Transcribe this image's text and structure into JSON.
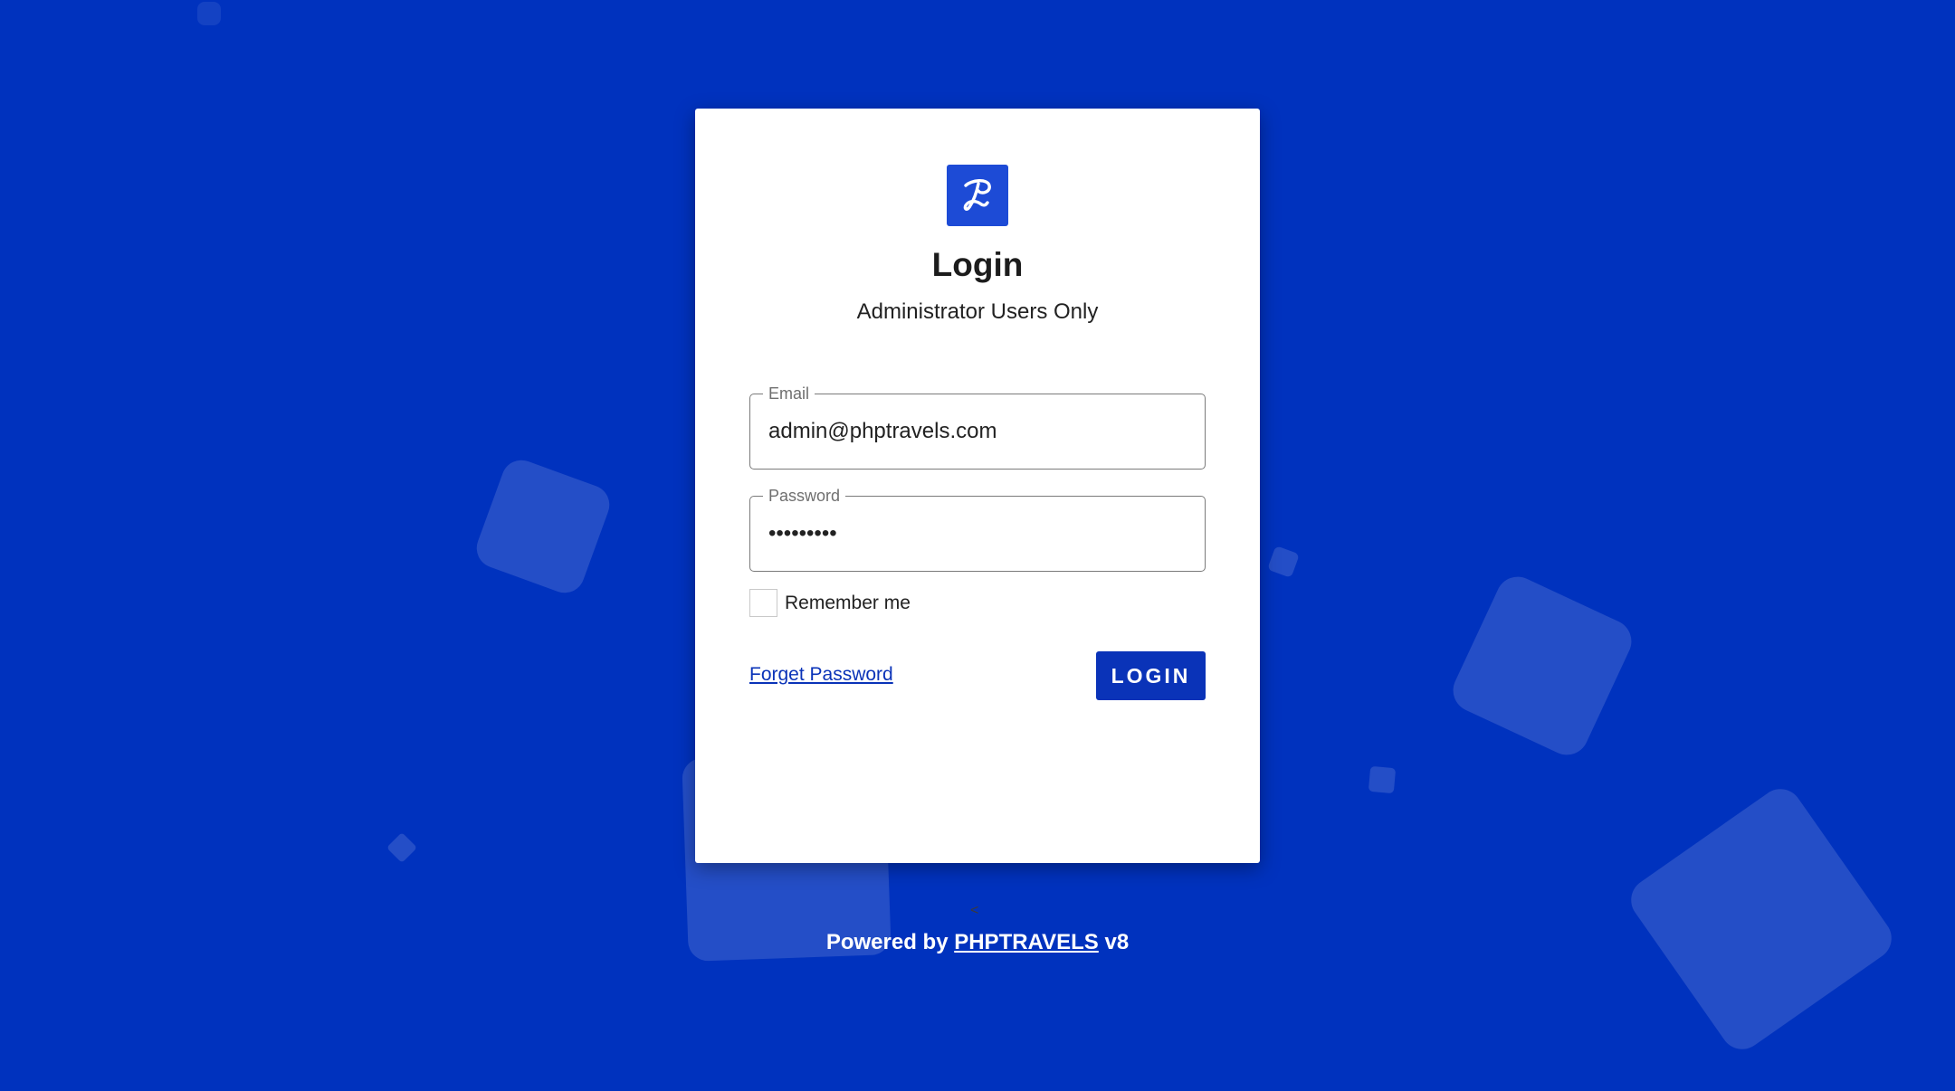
{
  "brand": {
    "logo_icon": "phptravels-p-logo-icon",
    "background_color": "#0032be",
    "accent_color": "#0a33b8"
  },
  "login": {
    "title": "Login",
    "subtitle": "Administrator Users Only",
    "email": {
      "label": "Email",
      "value": "admin@phptravels.com"
    },
    "password": {
      "label": "Password",
      "value": "demoadmin"
    },
    "remember_label": "Remember me",
    "remember_checked": false,
    "forget_label": "Forget Password",
    "login_button_label": "LOGIN"
  },
  "footer": {
    "arrow_glyph": "<",
    "powered_by": "Powered by",
    "brand_link": "PHPTRAVELS",
    "version": "v8"
  }
}
